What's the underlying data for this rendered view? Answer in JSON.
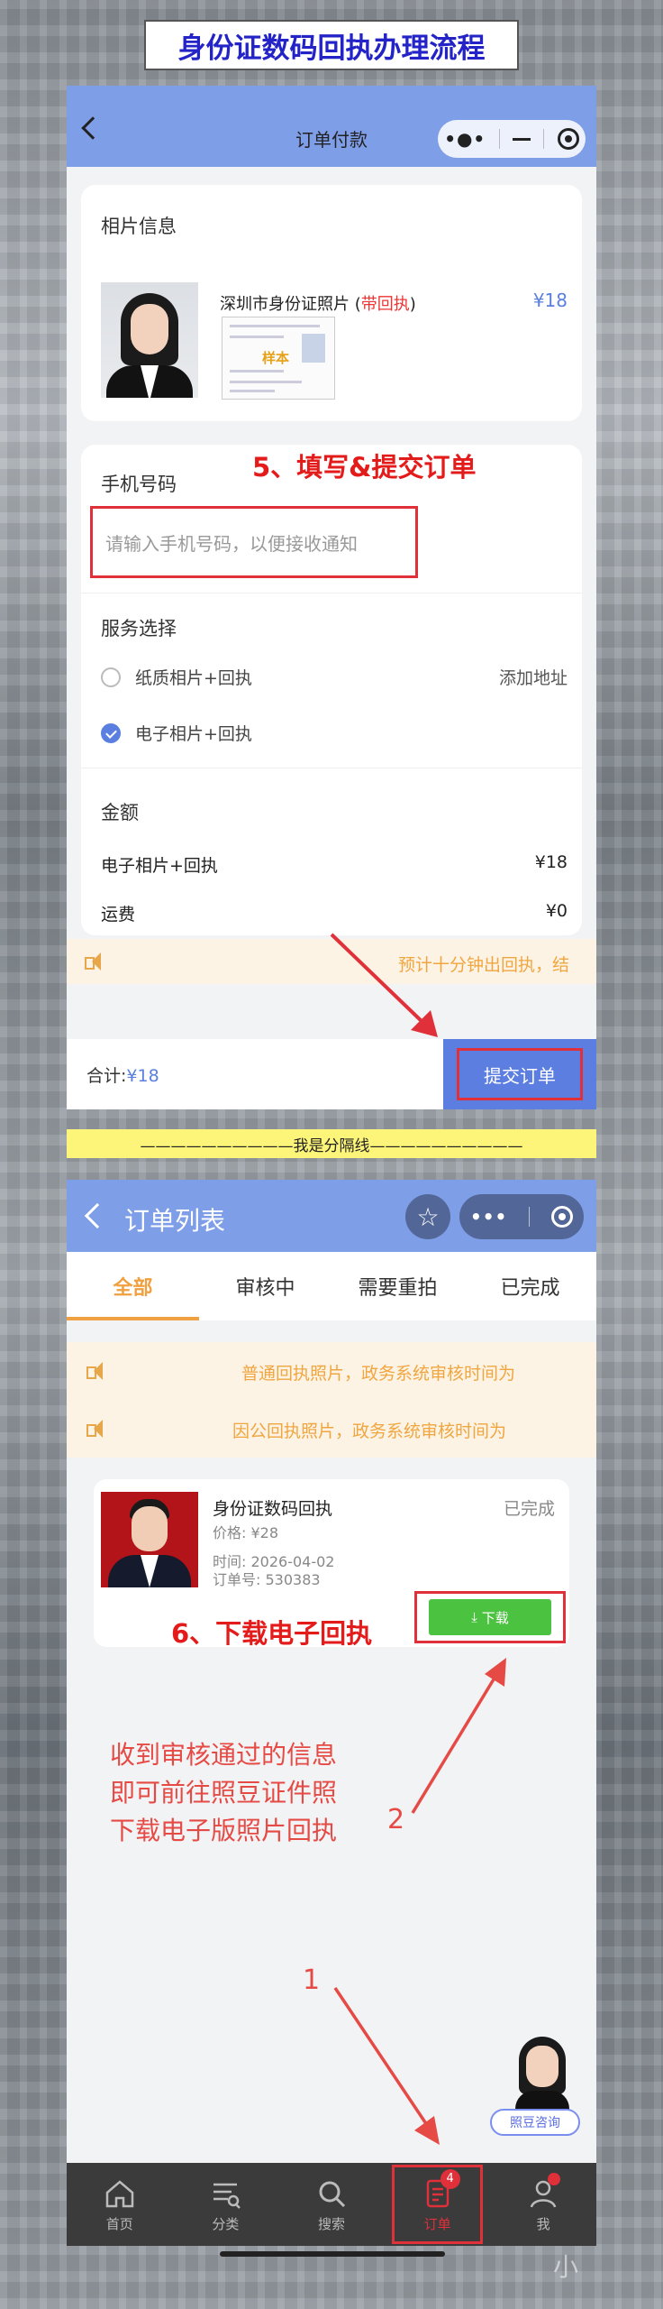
{
  "banner": {
    "title": "身份证数码回执办理流程"
  },
  "screen1": {
    "nav_title": "订单付款",
    "photo_section": {
      "title": "相片信息",
      "product_name": "深圳市身份证照片",
      "product_tag_open": " (",
      "product_tag": "带回执",
      "product_tag_close": ")",
      "price": "¥18",
      "sample_stamp": "样本"
    },
    "step_annotation": "5、填写&提交订单",
    "phone": {
      "label": "手机号码",
      "placeholder": "请输入手机号码，以便接收通知"
    },
    "service": {
      "label": "服务选择",
      "options": [
        {
          "label": "纸质相片+回执",
          "checked": false
        },
        {
          "label": "电子相片+回执",
          "checked": true
        }
      ],
      "add_address": "添加地址"
    },
    "amount": {
      "label": "金额",
      "rows": [
        {
          "label": "电子相片+回执",
          "value": "¥18"
        },
        {
          "label": "运费",
          "value": "¥0"
        }
      ]
    },
    "notice": "预计十分钟出回执，结",
    "bottom": {
      "total_label": "合计:",
      "total_value": "¥18",
      "submit": "提交订单"
    }
  },
  "separator": "——————————我是分隔线——————————",
  "screen2": {
    "nav_title": "订单列表",
    "tabs": [
      {
        "label": "全部",
        "active": true
      },
      {
        "label": "审核中",
        "active": false
      },
      {
        "label": "需要重拍",
        "active": false
      },
      {
        "label": "已完成",
        "active": false
      }
    ],
    "notices": [
      "普通回执照片，政务系统审核时间为",
      "因公回执照片，政务系统审核时间为"
    ],
    "order": {
      "title": "身份证数码回执",
      "status": "已完成",
      "price": "价格: ¥28",
      "time": "时间: 2026-04-02",
      "order_no": "订单号: 530383",
      "download": "下载"
    },
    "step_annotation": "6、下载电子回执",
    "instruction_lines": [
      "收到审核通过的信息",
      "即可前往照豆证件照",
      "下载电子版照片回执"
    ],
    "marker_1": "1",
    "marker_2": "2",
    "consult": "照豆咨询",
    "tabbar": [
      {
        "label": "首页",
        "icon": "home-icon"
      },
      {
        "label": "分类",
        "icon": "category-icon"
      },
      {
        "label": "搜索",
        "icon": "search-icon"
      },
      {
        "label": "订单",
        "icon": "order-icon",
        "badge": "4",
        "active": true
      },
      {
        "label": "我",
        "icon": "user-icon"
      }
    ]
  },
  "watermark": "小"
}
